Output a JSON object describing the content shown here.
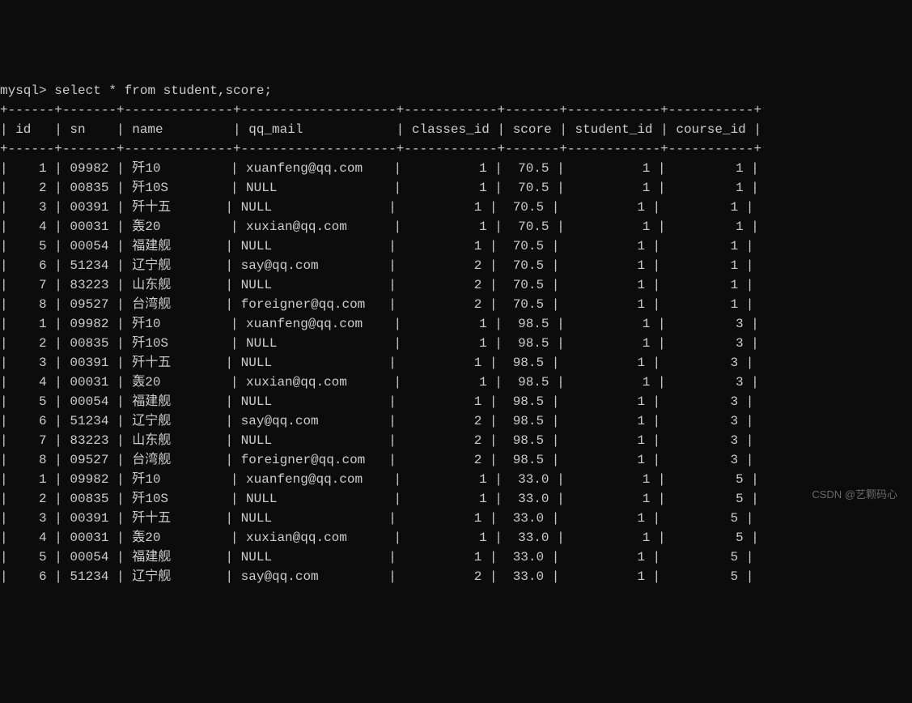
{
  "prompt": "mysql> ",
  "query": "select * from student,score;",
  "border_top": "+------+-------+--------------+--------------------+------------+-------+------------+-----------+",
  "header_line": "| id   | sn    | name         | qq_mail            | classes_id | score | student_id | course_id |",
  "border_mid": "+------+-------+--------------+--------------------+------------+-------+------------+-----------+",
  "columns": [
    "id",
    "sn",
    "name",
    "qq_mail",
    "classes_id",
    "score",
    "student_id",
    "course_id"
  ],
  "rows": [
    {
      "id": "1",
      "sn": "09982",
      "name": "歼10",
      "qq_mail": "xuanfeng@qq.com",
      "classes_id": "1",
      "score": "70.5",
      "student_id": "1",
      "course_id": "1"
    },
    {
      "id": "2",
      "sn": "00835",
      "name": "歼10S",
      "qq_mail": "NULL",
      "classes_id": "1",
      "score": "70.5",
      "student_id": "1",
      "course_id": "1"
    },
    {
      "id": "3",
      "sn": "00391",
      "name": "歼十五",
      "qq_mail": "NULL",
      "classes_id": "1",
      "score": "70.5",
      "student_id": "1",
      "course_id": "1"
    },
    {
      "id": "4",
      "sn": "00031",
      "name": "轰20",
      "qq_mail": "xuxian@qq.com",
      "classes_id": "1",
      "score": "70.5",
      "student_id": "1",
      "course_id": "1"
    },
    {
      "id": "5",
      "sn": "00054",
      "name": "福建舰",
      "qq_mail": "NULL",
      "classes_id": "1",
      "score": "70.5",
      "student_id": "1",
      "course_id": "1"
    },
    {
      "id": "6",
      "sn": "51234",
      "name": "辽宁舰",
      "qq_mail": "say@qq.com",
      "classes_id": "2",
      "score": "70.5",
      "student_id": "1",
      "course_id": "1"
    },
    {
      "id": "7",
      "sn": "83223",
      "name": "山东舰",
      "qq_mail": "NULL",
      "classes_id": "2",
      "score": "70.5",
      "student_id": "1",
      "course_id": "1"
    },
    {
      "id": "8",
      "sn": "09527",
      "name": "台湾舰",
      "qq_mail": "foreigner@qq.com",
      "classes_id": "2",
      "score": "70.5",
      "student_id": "1",
      "course_id": "1"
    },
    {
      "id": "1",
      "sn": "09982",
      "name": "歼10",
      "qq_mail": "xuanfeng@qq.com",
      "classes_id": "1",
      "score": "98.5",
      "student_id": "1",
      "course_id": "3"
    },
    {
      "id": "2",
      "sn": "00835",
      "name": "歼10S",
      "qq_mail": "NULL",
      "classes_id": "1",
      "score": "98.5",
      "student_id": "1",
      "course_id": "3"
    },
    {
      "id": "3",
      "sn": "00391",
      "name": "歼十五",
      "qq_mail": "NULL",
      "classes_id": "1",
      "score": "98.5",
      "student_id": "1",
      "course_id": "3"
    },
    {
      "id": "4",
      "sn": "00031",
      "name": "轰20",
      "qq_mail": "xuxian@qq.com",
      "classes_id": "1",
      "score": "98.5",
      "student_id": "1",
      "course_id": "3"
    },
    {
      "id": "5",
      "sn": "00054",
      "name": "福建舰",
      "qq_mail": "NULL",
      "classes_id": "1",
      "score": "98.5",
      "student_id": "1",
      "course_id": "3"
    },
    {
      "id": "6",
      "sn": "51234",
      "name": "辽宁舰",
      "qq_mail": "say@qq.com",
      "classes_id": "2",
      "score": "98.5",
      "student_id": "1",
      "course_id": "3"
    },
    {
      "id": "7",
      "sn": "83223",
      "name": "山东舰",
      "qq_mail": "NULL",
      "classes_id": "2",
      "score": "98.5",
      "student_id": "1",
      "course_id": "3"
    },
    {
      "id": "8",
      "sn": "09527",
      "name": "台湾舰",
      "qq_mail": "foreigner@qq.com",
      "classes_id": "2",
      "score": "98.5",
      "student_id": "1",
      "course_id": "3"
    },
    {
      "id": "1",
      "sn": "09982",
      "name": "歼10",
      "qq_mail": "xuanfeng@qq.com",
      "classes_id": "1",
      "score": "33.0",
      "student_id": "1",
      "course_id": "5"
    },
    {
      "id": "2",
      "sn": "00835",
      "name": "歼10S",
      "qq_mail": "NULL",
      "classes_id": "1",
      "score": "33.0",
      "student_id": "1",
      "course_id": "5"
    },
    {
      "id": "3",
      "sn": "00391",
      "name": "歼十五",
      "qq_mail": "NULL",
      "classes_id": "1",
      "score": "33.0",
      "student_id": "1",
      "course_id": "5"
    },
    {
      "id": "4",
      "sn": "00031",
      "name": "轰20",
      "qq_mail": "xuxian@qq.com",
      "classes_id": "1",
      "score": "33.0",
      "student_id": "1",
      "course_id": "5"
    },
    {
      "id": "5",
      "sn": "00054",
      "name": "福建舰",
      "qq_mail": "NULL",
      "classes_id": "1",
      "score": "33.0",
      "student_id": "1",
      "course_id": "5"
    },
    {
      "id": "6",
      "sn": "51234",
      "name": "辽宁舰",
      "qq_mail": "say@qq.com",
      "classes_id": "2",
      "score": "33.0",
      "student_id": "1",
      "course_id": "5"
    }
  ],
  "watermark": "CSDN @艺颗码心"
}
